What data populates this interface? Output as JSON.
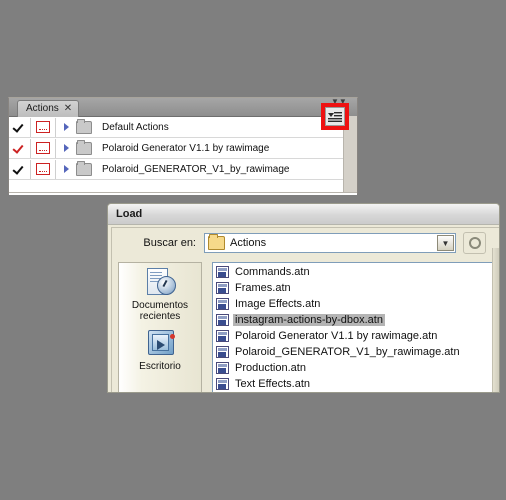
{
  "app": {
    "background_color": "#7f7f7f"
  },
  "actions_panel": {
    "tab_label": "Actions",
    "tab_close_glyph": "✕",
    "collapse_glyph": "▼▼",
    "menu_button_glyph": "▾≡",
    "highlight_color": "#ee1111",
    "rows": [
      {
        "label": "Default Actions",
        "checked": true,
        "check_color": "#111111",
        "dialog_toggle": true,
        "expanded": false
      },
      {
        "label": "Polaroid Generator V1.1 by rawimage",
        "checked": true,
        "check_color": "#cc2222",
        "dialog_toggle": true,
        "expanded": false
      },
      {
        "label": "Polaroid_GENERATOR_V1_by_rawimage",
        "checked": true,
        "check_color": "#111111",
        "dialog_toggle": true,
        "expanded": false
      }
    ]
  },
  "load_dialog": {
    "title": "Load",
    "lookin": {
      "label": "Buscar en:",
      "value": "Actions",
      "dropdown_glyph": "▼"
    },
    "places": [
      {
        "label": "Documentos\nrecientes",
        "label_line1": "Documentos",
        "label_line2": "recientes",
        "icon": "recent-documents-icon"
      },
      {
        "label": "Escritorio",
        "label_line1": "Escritorio",
        "label_line2": "",
        "icon": "desktop-icon"
      }
    ],
    "files": [
      {
        "name": "Commands.atn",
        "selected": false
      },
      {
        "name": "Frames.atn",
        "selected": false
      },
      {
        "name": "Image Effects.atn",
        "selected": false
      },
      {
        "name": "instagram-actions-by-dbox.atn",
        "selected": true
      },
      {
        "name": "Polaroid Generator V1.1 by rawimage.atn",
        "selected": false
      },
      {
        "name": "Polaroid_GENERATOR_V1_by_rawimage.atn",
        "selected": false
      },
      {
        "name": "Production.atn",
        "selected": false
      },
      {
        "name": "Text Effects.atn",
        "selected": false
      }
    ]
  }
}
